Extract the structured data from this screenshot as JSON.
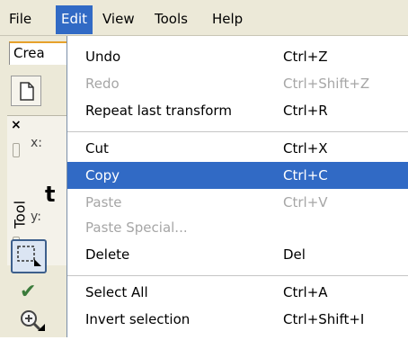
{
  "menubar": {
    "items": [
      {
        "label": "File"
      },
      {
        "label": "Edit"
      },
      {
        "label": "View"
      },
      {
        "label": "Tools"
      },
      {
        "label": "Help"
      }
    ],
    "active": "Edit"
  },
  "left": {
    "doc_tab": "Crea",
    "panel_label": "Tool",
    "x_label": "x:",
    "y_label": "y:",
    "close_glyph": "×",
    "bold_fragment": "t"
  },
  "menu": {
    "items": [
      {
        "label": "Undo",
        "shortcut": "Ctrl+Z",
        "enabled": true
      },
      {
        "label": "Redo",
        "shortcut": "Ctrl+Shift+Z",
        "enabled": false
      },
      {
        "label": "Repeat last transform",
        "shortcut": "Ctrl+R",
        "enabled": true
      },
      {
        "label": "Cut",
        "shortcut": "Ctrl+X",
        "enabled": true
      },
      {
        "label": "Copy",
        "shortcut": "Ctrl+C",
        "enabled": false,
        "highlighted": true
      },
      {
        "label": "Paste",
        "shortcut": "Ctrl+V",
        "enabled": false
      },
      {
        "label": "Paste Special...",
        "shortcut": "",
        "enabled": false
      },
      {
        "label": "Delete",
        "shortcut": "Del",
        "enabled": true
      },
      {
        "label": "Select All",
        "shortcut": "Ctrl+A",
        "enabled": true
      },
      {
        "label": "Invert selection",
        "shortcut": "Ctrl+Shift+I",
        "enabled": true
      }
    ]
  },
  "colors": {
    "highlight": "#316ac5",
    "menubar_bg": "#ece9d8",
    "disabled_text": "#a6a6a6",
    "accent_tab": "#e6a12b"
  },
  "icons": [
    "new-document-icon",
    "select-tool-icon",
    "pick-tool-icon",
    "zoom-tool-icon",
    "close-icon"
  ]
}
